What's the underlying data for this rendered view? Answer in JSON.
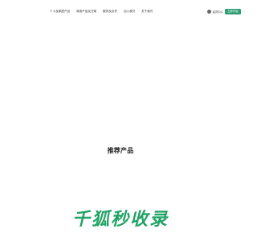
{
  "header": {
    "nav": [
      {
        "label": "个人及家庭产品"
      },
      {
        "label": "商用产品及方案"
      },
      {
        "label": "服务及合作"
      },
      {
        "label": "加入我们"
      },
      {
        "label": "关于我们"
      }
    ],
    "user": {
      "label": "会员中心",
      "cta_label": "立即开始"
    }
  },
  "main": {
    "section_title": "推荐产品"
  },
  "brand": {
    "logo_text": "千狐秒收录",
    "color": "#22a366"
  },
  "colors": {
    "accent": "#2c9d72",
    "background": "#ffffff"
  }
}
